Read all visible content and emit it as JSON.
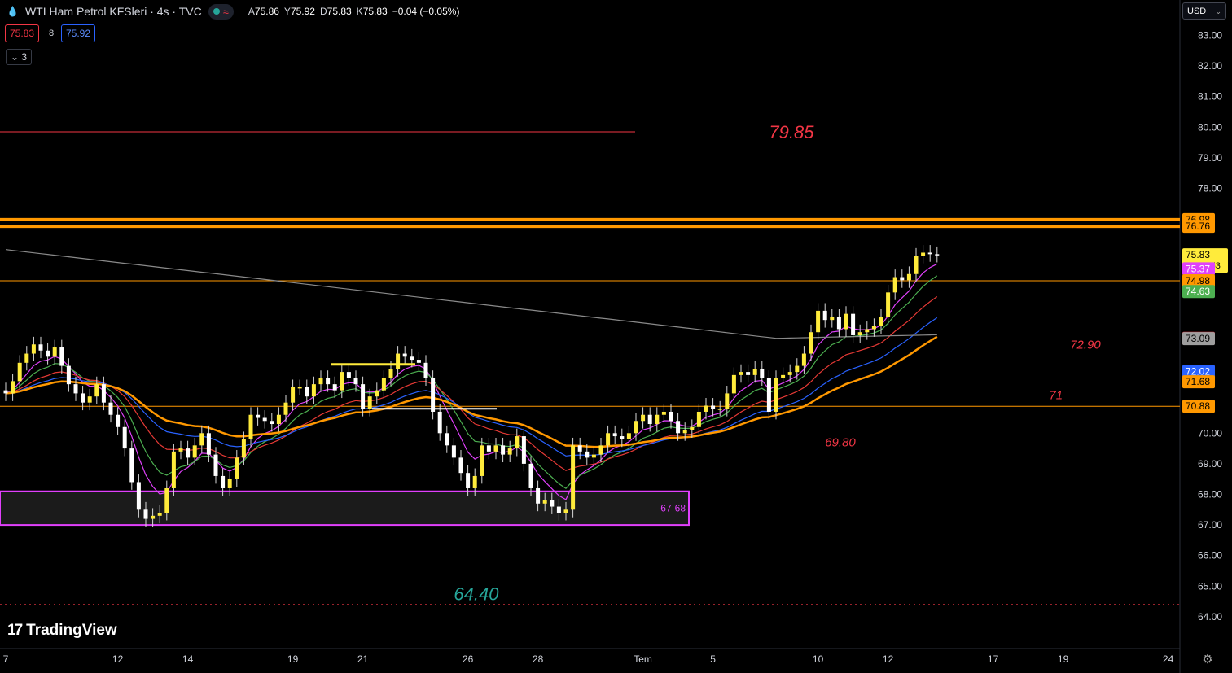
{
  "header": {
    "title": "WTI Ham Petrol KFSleri · 4s · TVC",
    "ohlc": {
      "o_label": "A",
      "o": "75.86",
      "h_label": "Y",
      "h": "75.92",
      "l_label": "D",
      "l": "75.83",
      "c_label": "K",
      "c": "75.83",
      "change": "−0.04 (−0.05%)"
    },
    "bid": "75.83",
    "spread": "8",
    "ask": "75.92",
    "indicators_toggle": "⌄ 3"
  },
  "currency": "USD",
  "logo_text": "TradingView",
  "colors": {
    "bg": "#000000",
    "candle": "#ffeb3b",
    "level_red": "#f23645",
    "orange": "#ff9800",
    "magenta": "#e040fb",
    "green": "#4caf50",
    "blue": "#2962ff",
    "gray": "#9e9e9e",
    "teal": "#26a69a"
  },
  "chart_data": {
    "type": "candlestick",
    "ylim": [
      63.2,
      83.9
    ],
    "y_ticks": [
      "83.00",
      "82.00",
      "81.00",
      "80.00",
      "79.00",
      "78.00",
      "70.00",
      "69.00",
      "68.00",
      "67.00",
      "66.00",
      "65.00",
      "64.00"
    ],
    "x_ticks": [
      {
        "label": "7",
        "bar": 0
      },
      {
        "label": "12",
        "bar": 16
      },
      {
        "label": "14",
        "bar": 26
      },
      {
        "label": "19",
        "bar": 41
      },
      {
        "label": "21",
        "bar": 51
      },
      {
        "label": "26",
        "bar": 66
      },
      {
        "label": "28",
        "bar": 76
      },
      {
        "label": "Tem",
        "bar": 91
      },
      {
        "label": "5",
        "bar": 101
      },
      {
        "label": "10",
        "bar": 116
      },
      {
        "label": "12",
        "bar": 126
      },
      {
        "label": "17",
        "bar": 141
      },
      {
        "label": "19",
        "bar": 151
      },
      {
        "label": "24",
        "bar": 166
      }
    ],
    "closes": [
      71.3,
      71.7,
      72.3,
      72.6,
      72.9,
      72.7,
      72.5,
      72.8,
      72.2,
      71.6,
      71.3,
      71.0,
      71.2,
      71.6,
      71.0,
      70.6,
      70.2,
      69.5,
      68.4,
      67.5,
      67.2,
      67.3,
      67.4,
      68.2,
      69.4,
      69.5,
      69.2,
      69.6,
      70.0,
      69.3,
      68.6,
      68.2,
      68.5,
      69.2,
      69.8,
      70.6,
      70.5,
      70.4,
      70.3,
      70.6,
      71.0,
      71.5,
      71.5,
      71.2,
      71.6,
      71.8,
      71.6,
      71.4,
      72.0,
      71.8,
      71.6,
      70.8,
      71.2,
      71.4,
      71.8,
      72.1,
      72.6,
      72.5,
      72.4,
      72.3,
      71.8,
      70.7,
      70.0,
      69.6,
      69.2,
      68.7,
      68.2,
      68.6,
      69.6,
      69.4,
      69.6,
      69.3,
      69.5,
      69.9,
      69.0,
      68.2,
      67.7,
      67.8,
      67.6,
      67.4,
      67.5,
      69.6,
      69.4,
      69.2,
      69.3,
      69.6,
      70.0,
      69.9,
      69.8,
      70.0,
      70.4,
      70.6,
      70.3,
      70.6,
      70.7,
      70.4,
      70.0,
      70.1,
      70.2,
      70.7,
      70.9,
      70.8,
      70.8,
      71.3,
      71.9,
      72.0,
      71.9,
      72.1,
      71.8,
      70.7,
      71.8,
      71.9,
      72.0,
      72.2,
      72.6,
      73.3,
      74.0,
      73.7,
      73.8,
      73.4,
      73.9,
      73.2,
      73.3,
      73.4,
      73.5,
      73.8,
      74.6,
      75.1,
      75.0,
      75.2,
      75.8,
      75.9,
      75.85,
      75.83
    ],
    "levels": [
      {
        "value": 79.85,
        "label": "79.85",
        "color": "#f23645",
        "style": "solid"
      },
      {
        "value": 76.98,
        "label": "76.98",
        "color": "#ff9800",
        "style": "thick"
      },
      {
        "value": 76.76,
        "label": "76.76",
        "color": "#ff9800",
        "style": "thick"
      },
      {
        "value": 74.98,
        "label": "74.98",
        "color": "#ff9800",
        "style": "thin"
      },
      {
        "value": 70.88,
        "label": "70.88",
        "color": "#ff9800",
        "style": "thin"
      },
      {
        "value": 64.4,
        "label": "64.40",
        "color": "#f23645",
        "style": "dotted"
      }
    ],
    "zone": {
      "low": 67.0,
      "high": 68.1,
      "label": "67-68",
      "color": "#e040fb"
    },
    "annotations": [
      {
        "text": "79.85",
        "color": "#f23645",
        "bar": 109,
        "value": 79.85
      },
      {
        "text": "64.40",
        "color": "#26a69a",
        "bar": 64,
        "value": 64.75
      },
      {
        "text": "72.90",
        "color": "#f23645",
        "bar": 152,
        "value": 72.9
      },
      {
        "text": "71",
        "color": "#f23645",
        "bar": 149,
        "value": 71.25
      },
      {
        "text": "69.80",
        "color": "#f23645",
        "bar": 117,
        "value": 69.7
      }
    ],
    "price_labels": [
      {
        "value": 76.98,
        "text": "76.98",
        "bg": "#ff9800",
        "fg": "#000"
      },
      {
        "value": 76.76,
        "text": "76.76",
        "bg": "#ff9800",
        "fg": "#000"
      },
      {
        "value": 75.83,
        "text": "75.83",
        "bg": "#ffeb3b",
        "fg": "#000",
        "sub": "03:32:53"
      },
      {
        "value": 75.37,
        "text": "75.37",
        "bg": "#e040fb",
        "fg": "#fff"
      },
      {
        "value": 74.98,
        "text": "74.98",
        "bg": "#ff9800",
        "fg": "#000"
      },
      {
        "value": 74.63,
        "text": "74.63",
        "bg": "#4caf50",
        "fg": "#fff"
      },
      {
        "value": 73.1,
        "text": "73.10",
        "bg": "#f23645",
        "fg": "#fff"
      },
      {
        "value": 73.09,
        "text": "73.09",
        "bg": "#9e9e9e",
        "fg": "#000"
      },
      {
        "value": 72.02,
        "text": "72.02",
        "bg": "#2962ff",
        "fg": "#fff"
      },
      {
        "value": 71.68,
        "text": "71.68",
        "bg": "#ff9800",
        "fg": "#000"
      },
      {
        "value": 70.88,
        "text": "70.88",
        "bg": "#ff9800",
        "fg": "#000"
      }
    ]
  }
}
